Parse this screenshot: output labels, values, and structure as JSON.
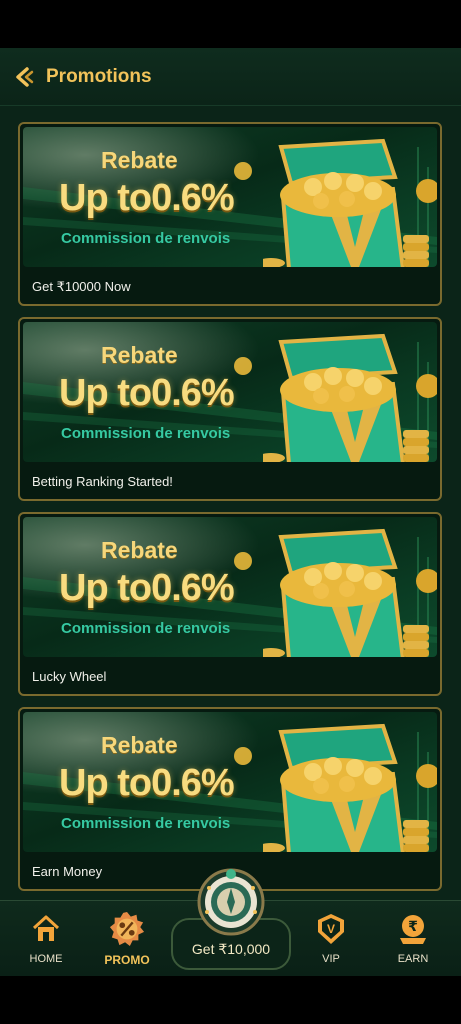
{
  "header": {
    "title": "Promotions",
    "back_icon": "chevron-left-icon"
  },
  "promotions": [
    {
      "banner": {
        "line1": "Rebate",
        "line2": "Up to0.6%",
        "line3": "Commission de renvois"
      },
      "label": "Get ₹10000 Now"
    },
    {
      "banner": {
        "line1": "Rebate",
        "line2": "Up to0.6%",
        "line3": "Commission de renvois"
      },
      "label": "Betting Ranking Started!"
    },
    {
      "banner": {
        "line1": "Rebate",
        "line2": "Up to0.6%",
        "line3": "Commission de renvois"
      },
      "label": "Lucky Wheel"
    },
    {
      "banner": {
        "line1": "Rebate",
        "line2": "Up to0.6%",
        "line3": "Commission de renvois"
      },
      "label": "Earn Money"
    }
  ],
  "tabbar": {
    "home": {
      "label": "HOME",
      "icon": "home-icon"
    },
    "promo": {
      "label": "PROMO",
      "icon": "gift-icon",
      "active": true
    },
    "center": {
      "label": "Get ₹10,000",
      "icon": "wheel-icon"
    },
    "vip": {
      "label": "VIP",
      "icon": "vip-badge-icon"
    },
    "earn": {
      "label": "EARN",
      "icon": "rupee-icon"
    }
  },
  "colors": {
    "accent": "#f2c35a",
    "background": "#0b2418",
    "card_border": "#7a6a2e",
    "teal_text": "#36c9a2"
  }
}
